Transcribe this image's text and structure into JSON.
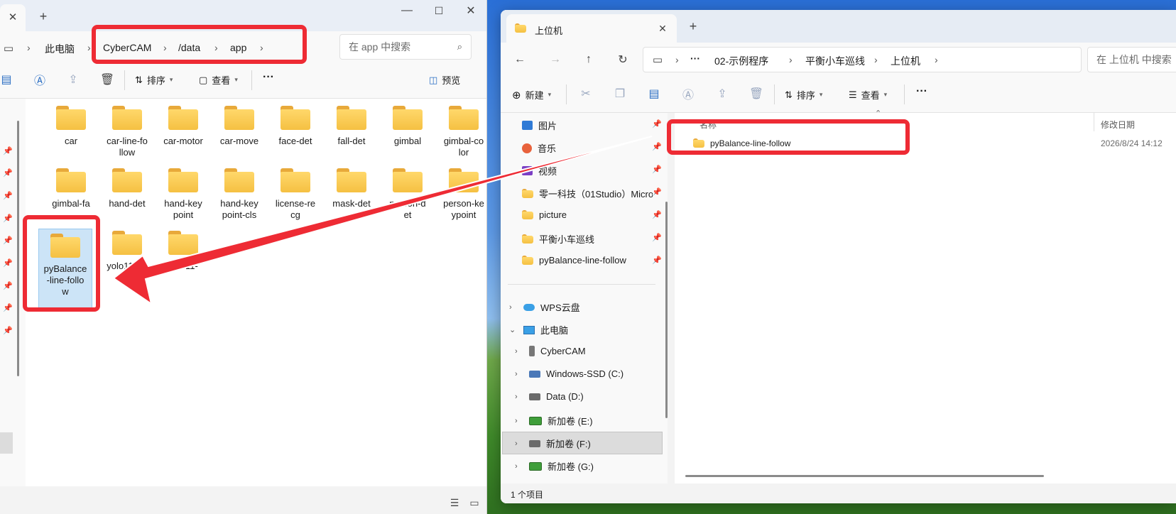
{
  "left_window": {
    "breadcrumb": [
      "此电脑",
      "CyberCAM",
      "/data",
      "app"
    ],
    "search_placeholder": "在 app 中搜索",
    "commands": {
      "sort": "排序",
      "view": "查看",
      "more": "···",
      "preview": "预览"
    },
    "folders": [
      "car",
      "car-line-fo\nllow",
      "car-motor",
      "car-move",
      "face-det",
      "fall-det",
      "gimbal",
      "gimbal-co\nlor",
      "gimbal-fa",
      "hand-det",
      "hand-key\npoint",
      "hand-key\npoint-cls",
      "license-re\ncg",
      "mask-det",
      "person-d\net",
      "person-ke\nypoint",
      "pyBalance\n-line-follo\nw",
      "yolo11-cls",
      "yolo11-"
    ]
  },
  "right_window": {
    "tab_title": "上位机",
    "breadcrumb": [
      "···",
      "02-示例程序",
      "平衡小车巡线",
      "上位机"
    ],
    "search_placeholder": "在 上位机 中搜索",
    "commands": {
      "new": "新建",
      "sort": "排序",
      "view": "查看",
      "more": "···"
    },
    "quick_access": [
      "图片",
      "音乐",
      "视频",
      "零一科技（01Studio）Micro",
      "picture",
      "平衡小车巡线",
      "pyBalance-line-follow"
    ],
    "tree": {
      "wps": "WPS云盘",
      "this_pc": "此电脑",
      "drives": [
        "CyberCAM",
        "Windows-SSD (C:)",
        "Data (D:)",
        "新加卷 (E:)",
        "新加卷 (F:)",
        "新加卷 (G:)"
      ]
    },
    "columns": {
      "name": "名称",
      "modified": "修改日期"
    },
    "files": [
      {
        "name": "pyBalance-line-follow",
        "modified": "2026/8/24 14:12"
      }
    ],
    "status": "1 个项目"
  },
  "annotation_color": "#ee2b34"
}
